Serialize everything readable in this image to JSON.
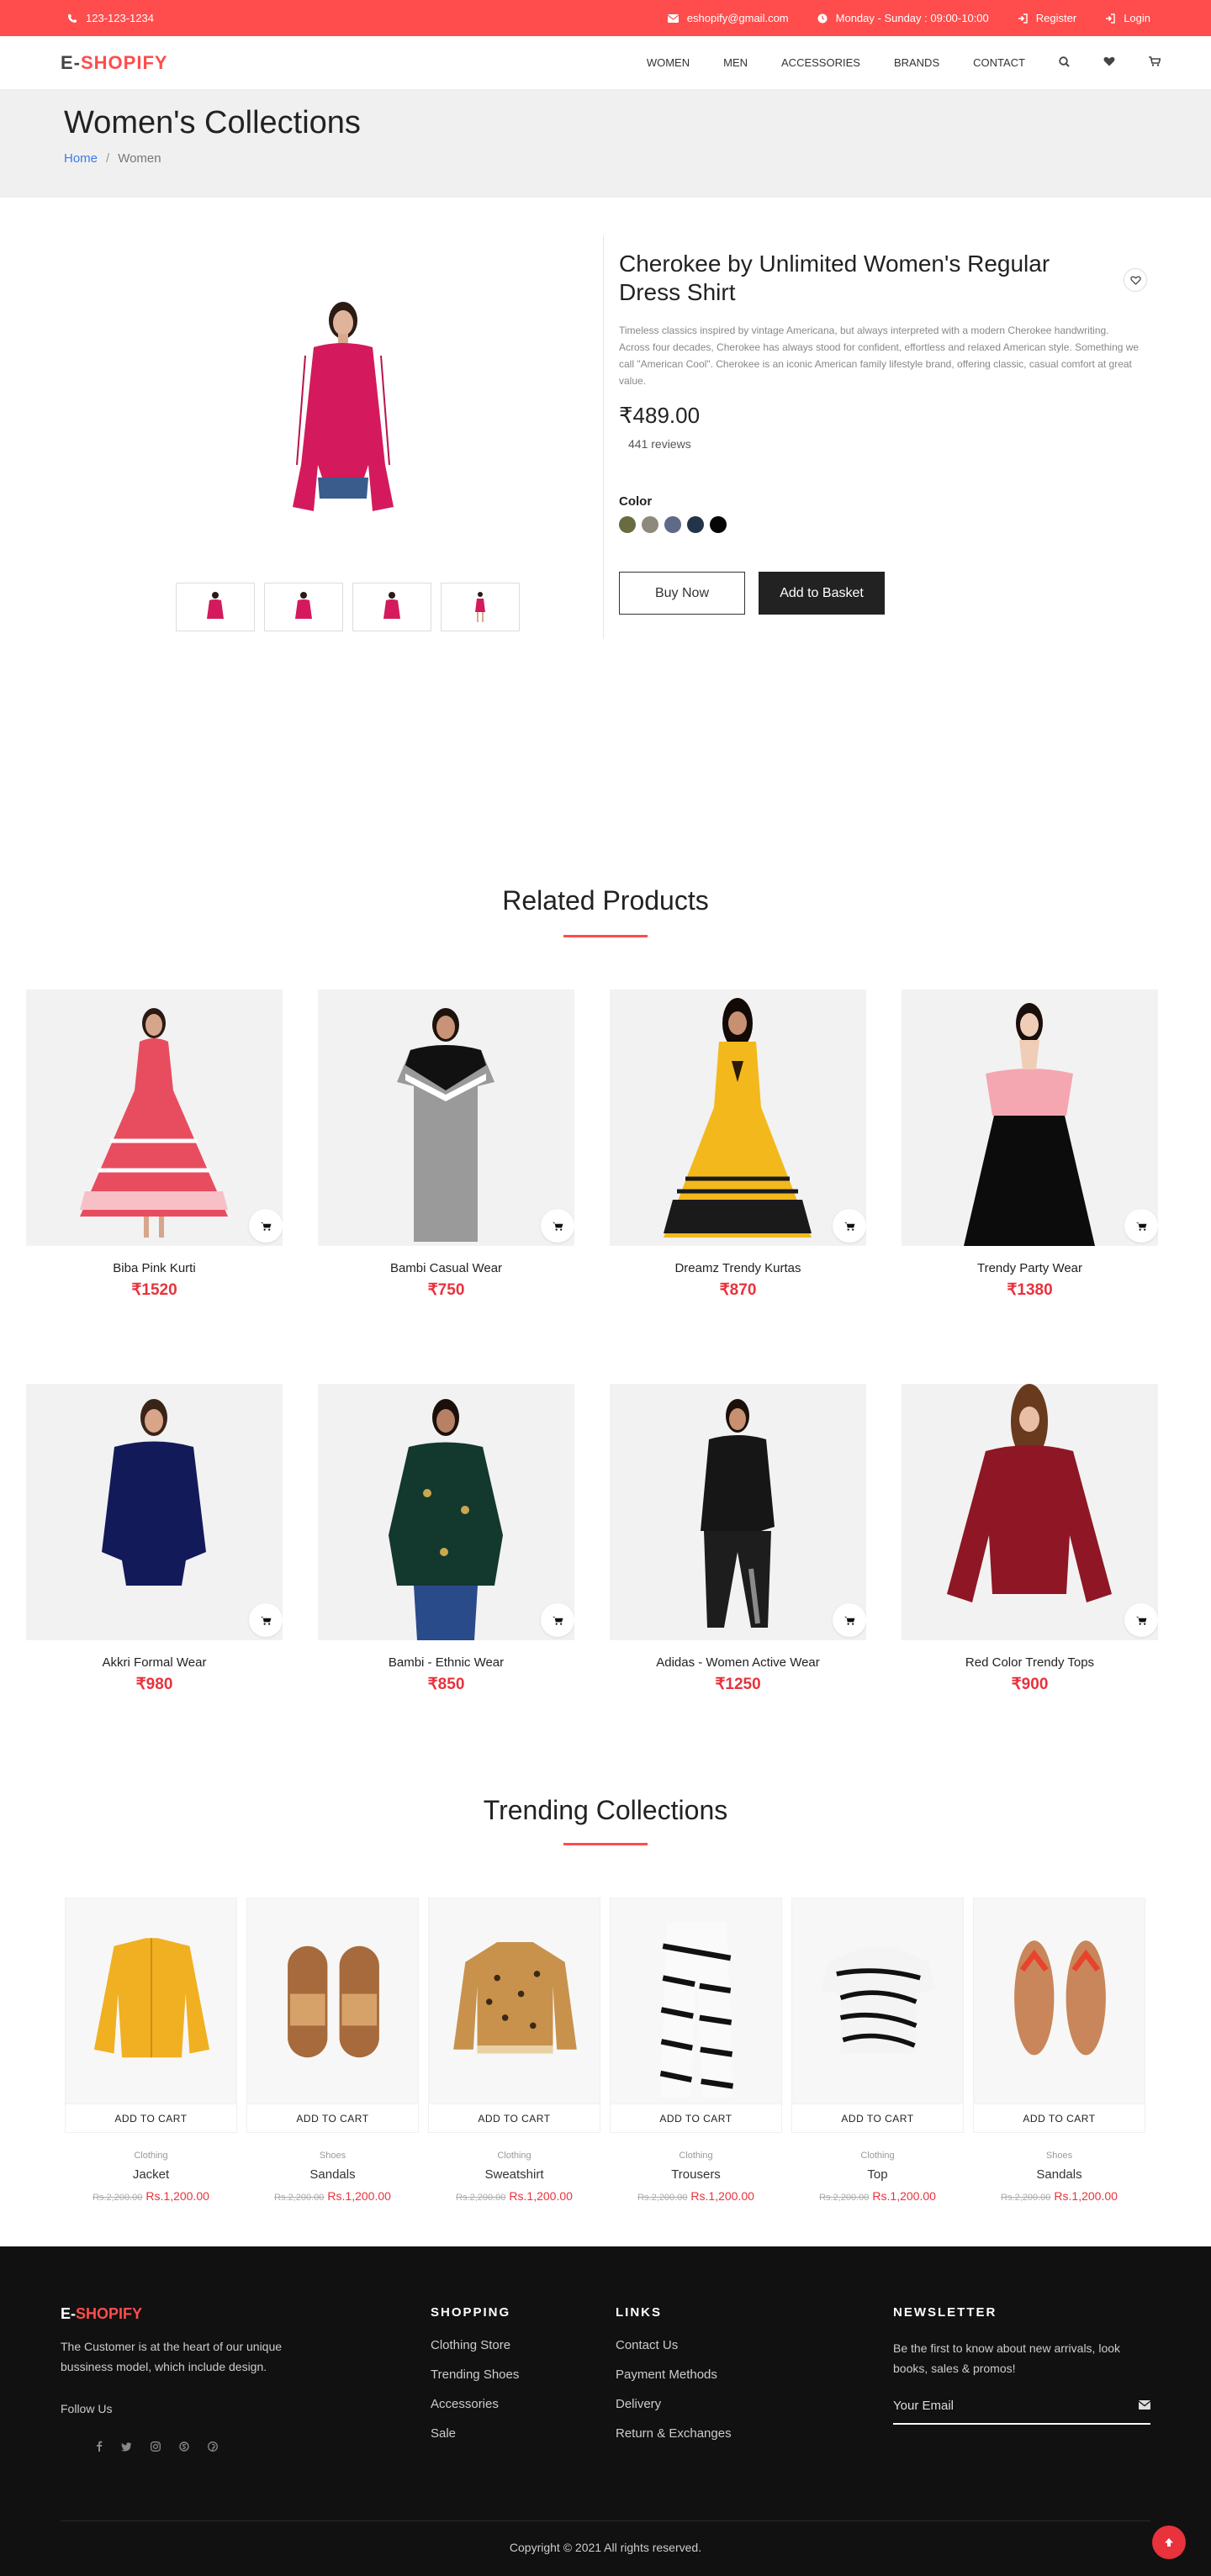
{
  "topbar": {
    "phone": "123-123-1234",
    "email": "eshopify@gmail.com",
    "hours": "Monday - Sunday : 09:00-10:00",
    "register": "Register",
    "login": "Login"
  },
  "brand": {
    "prefix": "E-",
    "name": "SHOPIFY"
  },
  "nav": {
    "items": [
      "WOMEN",
      "MEN",
      "ACCESSORIES",
      "BRANDS",
      "CONTACT"
    ]
  },
  "hero": {
    "title": "Women's Collections",
    "crumb_home": "Home",
    "crumb_sep": "/",
    "crumb_current": "Women"
  },
  "product": {
    "title": "Cherokee by Unlimited Women's Regular Dress Shirt",
    "description": "Timeless classics inspired by vintage Americana, but always interpreted with a modern Cherokee handwriting. Across four decades, Cherokee has always stood for confident, effortless and relaxed American style. Something we call \"American Cool\". Cherokee is an iconic American family lifestyle brand, offering classic, casual comfort at great value.",
    "price": "₹489.00",
    "reviews": "441 reviews",
    "color_label": "Color",
    "colors": [
      "#6b6b42",
      "#8d8a7c",
      "#5d6a88",
      "#233449",
      "#050505"
    ],
    "buy_now": "Buy Now",
    "add_to_basket": "Add to Basket"
  },
  "related": {
    "title": "Related Products",
    "items": [
      {
        "name": "Biba Pink Kurti",
        "price": "₹1520"
      },
      {
        "name": "Bambi Casual Wear",
        "price": "₹750"
      },
      {
        "name": "Dreamz Trendy Kurtas",
        "price": "₹870"
      },
      {
        "name": "Trendy Party Wear",
        "price": "₹1380"
      },
      {
        "name": "Akkri Formal Wear",
        "price": "₹980"
      },
      {
        "name": "Bambi - Ethnic Wear",
        "price": "₹850"
      },
      {
        "name": "Adidas - Women Active Wear",
        "price": "₹1250"
      },
      {
        "name": "Red Color Trendy Tops",
        "price": "₹900"
      }
    ]
  },
  "trending": {
    "title": "Trending Collections",
    "add_label": "ADD TO CART",
    "items": [
      {
        "category": "Clothing",
        "name": "Jacket",
        "old_price": "Rs.2,200.00",
        "price": "Rs.1,200.00"
      },
      {
        "category": "Shoes",
        "name": "Sandals",
        "old_price": "Rs.2,200.00",
        "price": "Rs.1,200.00"
      },
      {
        "category": "Clothing",
        "name": "Sweatshirt",
        "old_price": "Rs.2,200.00",
        "price": "Rs.1,200.00"
      },
      {
        "category": "Clothing",
        "name": "Trousers",
        "old_price": "Rs.2,200.00",
        "price": "Rs.1,200.00"
      },
      {
        "category": "Clothing",
        "name": "Top",
        "old_price": "Rs.2,200.00",
        "price": "Rs.1,200.00"
      },
      {
        "category": "Shoes",
        "name": "Sandals",
        "old_price": "Rs.2,200.00",
        "price": "Rs.1,200.00"
      }
    ]
  },
  "footer": {
    "about": "The Customer is at the heart of our unique bussiness model, which include design.",
    "follow": "Follow Us",
    "shopping_title": "SHOPPING",
    "shopping": [
      "Clothing Store",
      "Trending Shoes",
      "Accessories",
      "Sale"
    ],
    "links_title": "LINKS",
    "links": [
      "Contact Us",
      "Payment Methods",
      "Delivery",
      "Return & Exchanges"
    ],
    "newsletter_title": "NEWSLETTER",
    "newsletter_text": "Be the first to know about new arrivals, look books, sales & promos!",
    "email_placeholder": "Your Email",
    "copyright": "Copyright © 2021 All rights reserved."
  },
  "colors": {
    "accent": "#ff4c4c",
    "price": "#e8323c",
    "dark": "#111111"
  }
}
